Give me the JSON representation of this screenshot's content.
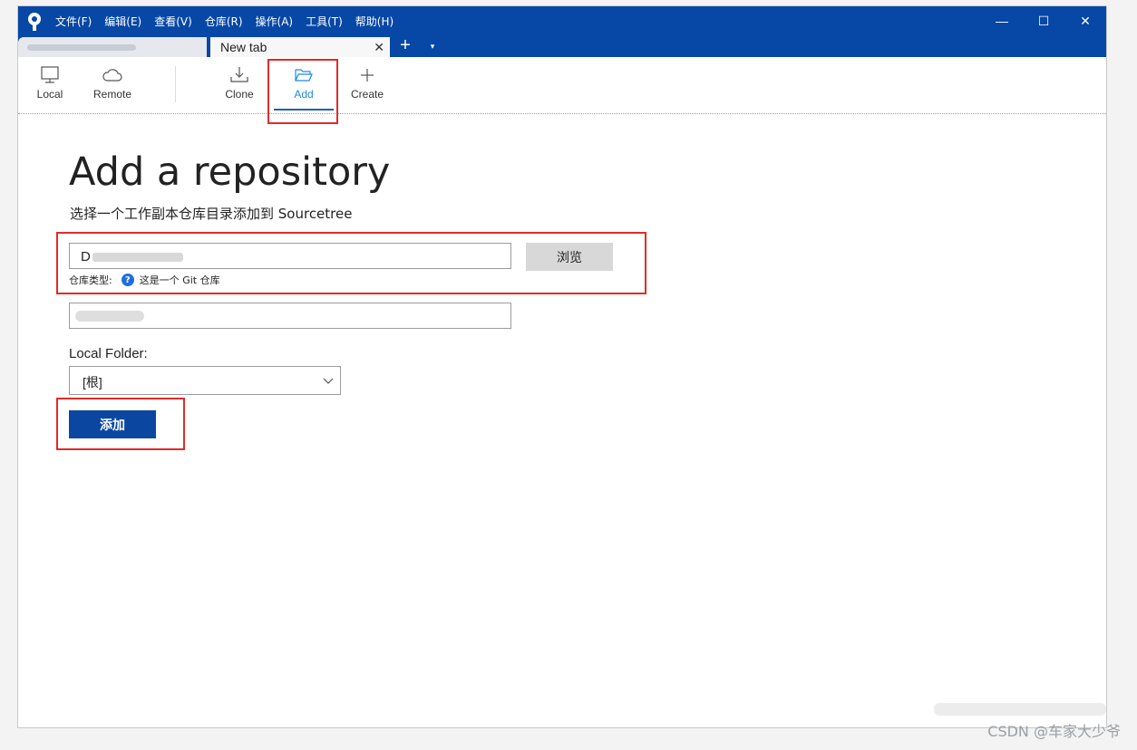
{
  "menu": [
    "文件(F)",
    "编辑(E)",
    "查看(V)",
    "仓库(R)",
    "操作(A)",
    "工具(T)",
    "帮助(H)"
  ],
  "window_controls": {
    "minimize": "—",
    "maximize": "☐",
    "close": "✕"
  },
  "tabs": {
    "active_label": "New tab",
    "close": "✕",
    "new_tab": "+",
    "dropdown": "▾"
  },
  "toolbar": {
    "local": "Local",
    "remote": "Remote",
    "clone": "Clone",
    "add": "Add",
    "create": "Create",
    "active": "Add"
  },
  "page": {
    "title": "Add a repository",
    "subtitle": "选择一个工作副本仓库目录添加到 Sourcetree",
    "path_value": "D",
    "browse_label": "浏览",
    "repo_type_label": "仓库类型:",
    "repo_type_value": "这是一个 Git 仓库",
    "help_icon": "?",
    "local_folder_label": "Local Folder:",
    "local_folder_value": "[根]",
    "add_label": "添加"
  },
  "watermark": "CSDN @车家大少爷",
  "colors": {
    "titlebar": "#0747a6",
    "add_button": "#0b47a1",
    "annotation": "#e02b2b",
    "active_tab_text": "#1e88e5"
  }
}
